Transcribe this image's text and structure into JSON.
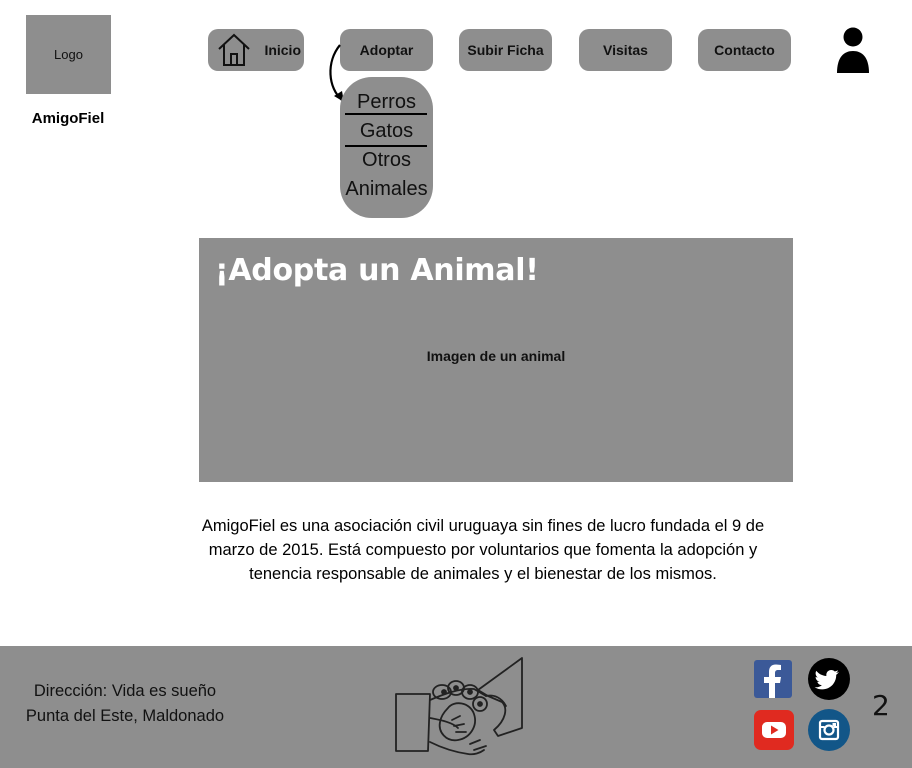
{
  "header": {
    "logo_text": "Logo",
    "brand": "AmigoFiel"
  },
  "nav": {
    "inicio": "Inicio",
    "adoptar": "Adoptar",
    "subir_ficha": "Subir Ficha",
    "visitas": "Visitas",
    "contacto": "Contacto"
  },
  "dropdown": {
    "items": [
      "Perros",
      "Gatos",
      "Otros",
      "Animales"
    ]
  },
  "hero": {
    "title": "¡Adopta un Animal!",
    "image_placeholder": "Imagen de un animal"
  },
  "description": "AmigoFiel es una asociación civil uruguaya sin fines de lucro fundada el 9 de marzo de 2015. Está compuesto por voluntarios que fomenta la adopción y tenencia responsable de animales y el bienestar de los mismos.",
  "footer": {
    "address_line1": "Dirección: Vida es sueño",
    "address_line2": "Punta del Este, Maldonado",
    "page_number": "2"
  },
  "icons": [
    "home-icon",
    "user-icon",
    "facebook-icon",
    "twitter-icon",
    "youtube-icon",
    "instagram-icon",
    "handshake-paw-icon"
  ],
  "colors": {
    "gray": "#8e8e8e",
    "facebook": "#3b5998",
    "youtube": "#e02a20",
    "instagram": "#125688"
  }
}
